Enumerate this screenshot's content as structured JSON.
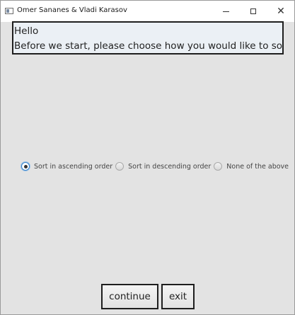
{
  "window": {
    "title": "Omer Sananes & Vladi Karasov",
    "controls": {
      "minimize": "minimize",
      "maximize": "maximize",
      "close": "close"
    }
  },
  "greeting": {
    "line1": "Hello",
    "line2": "Before we start, please choose how you would like to sort"
  },
  "sort_options": {
    "selected": "Sort in ascending order",
    "items": [
      {
        "label": "Sort in ascending order",
        "checked": true
      },
      {
        "label": "Sort in descending order",
        "checked": false
      },
      {
        "label": "None of the above",
        "checked": false
      }
    ]
  },
  "buttons": {
    "continue_label": "continue",
    "exit_label": "exit"
  },
  "icons": [
    "app-window-icon",
    "minimize-icon",
    "maximize-icon",
    "close-icon",
    "radio-icon"
  ]
}
